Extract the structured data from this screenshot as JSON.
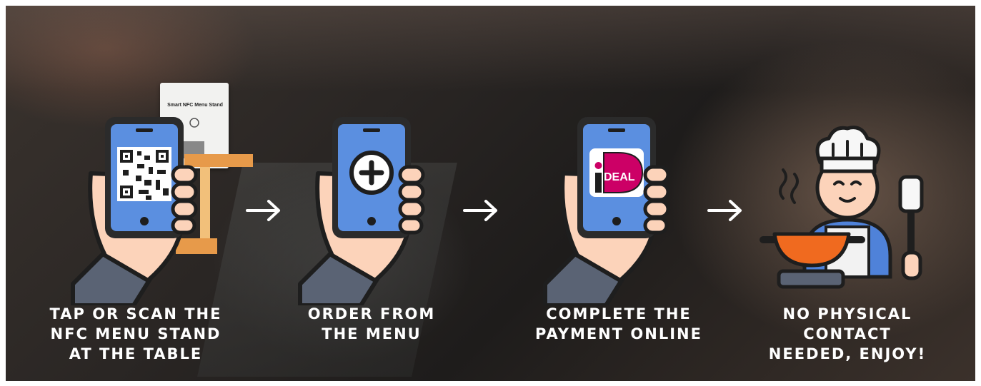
{
  "steps": [
    {
      "caption_lines": [
        "TAP OR SCAN THE",
        "NFC MENU STAND",
        "AT THE TABLE"
      ],
      "icon": "phone-qr-icon"
    },
    {
      "caption_lines": [
        "ORDER FROM",
        "THE MENU"
      ],
      "icon": "phone-plus-icon"
    },
    {
      "caption_lines": [
        "COMPLETE THE",
        "PAYMENT ONLINE"
      ],
      "icon": "phone-ideal-icon"
    },
    {
      "caption_lines": [
        "NO PHYSICAL",
        "CONTACT",
        "NEEDED, ENJOY!"
      ],
      "icon": "chef-icon"
    }
  ],
  "stand": {
    "title": "Smart NFC Menu Stand"
  },
  "payment": {
    "logo_text": "DEAL",
    "logo_letter": "i"
  },
  "colors": {
    "phone_body": "#2b2b2b",
    "phone_screen": "#5b8fe0",
    "skin": "#fcd3ba",
    "sleeve": "#5a6374",
    "stand_wood": "#e79a4a",
    "ideal_pink": "#cc0066",
    "pan_orange": "#f06a1f",
    "apron_blue": "#4f82d9"
  },
  "arrows": [
    "arrow-right-icon",
    "arrow-right-icon",
    "arrow-right-icon"
  ]
}
